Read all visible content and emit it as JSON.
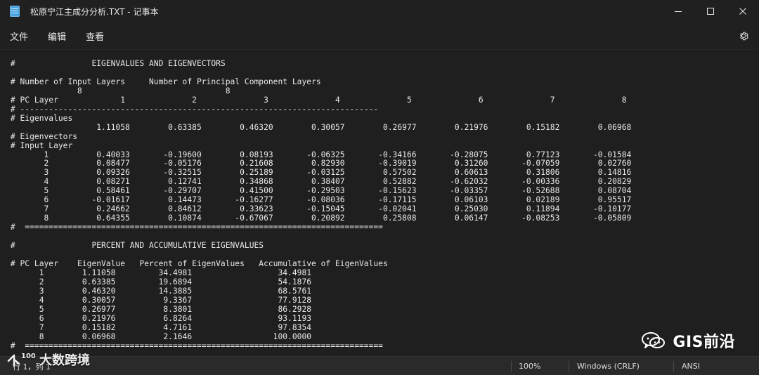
{
  "window": {
    "title": "松原宁江主成分分析.TXT - 记事本",
    "controls": [
      "minimize",
      "maximize",
      "close"
    ]
  },
  "menu": {
    "items": [
      "文件",
      "编辑",
      "查看"
    ],
    "settings_icon": "gear-icon"
  },
  "document": {
    "lines": [
      "#                EIGENVALUES AND EIGENVECTORS",
      "",
      "# Number of Input Layers     Number of Principal Component Layers",
      "              8                              8",
      "# PC Layer             1              2              3              4              5              6              7              8",
      "# ---------------------------------------------------------------------------",
      "# Eigenvalues",
      "                  1.11058        0.63385        0.46320        0.30057        0.26977        0.21976        0.15182        0.06968",
      "# Eigenvectors",
      "# Input Layer",
      "       1          0.40033       -0.19600        0.08193       -0.06325       -0.34166       -0.28075        0.77123       -0.01584",
      "       2          0.08477       -0.05176        0.21608        0.82930       -0.39019        0.31260       -0.07059        0.02760",
      "       3          0.09326       -0.32515        0.25189       -0.03125        0.57502        0.60613        0.31806        0.14816",
      "       4          0.08271        0.12741        0.34868        0.38407        0.52882       -0.62032       -0.00336        0.20829",
      "       5          0.58461       -0.29707        0.41500       -0.29503       -0.15623       -0.03357       -0.52688        0.08704",
      "       6         -0.01617        0.14473       -0.16277       -0.08036       -0.17115        0.06103        0.02189        0.95517",
      "       7          0.24662        0.84612        0.33623       -0.15045       -0.02041        0.25030        0.11894       -0.10177",
      "       8          0.64355        0.10874       -0.67067        0.20892        0.25808        0.06147       -0.08253       -0.05809",
      "#  ===========================================================================",
      "",
      "#                PERCENT AND ACCUMULATIVE EIGENVALUES",
      "",
      "# PC Layer    EigenValue   Percent of EigenValues   Accumulative of EigenValues",
      "      1        1.11058         34.4981                  34.4981",
      "      2        0.63385         19.6894                  54.1876",
      "      3        0.46320         14.3885                  68.5761",
      "      4        0.30057          9.3367                  77.9128",
      "      5        0.26977          8.3801                  86.2928",
      "      6        0.21976          6.8264                  93.1193",
      "      7        0.15182          4.7161                  97.8354",
      "      8        0.06968          2.1646                 100.0000",
      "#  ==========================================================================="
    ]
  },
  "status": {
    "cursor": "行 1，列 1",
    "zoom": "100%",
    "line_ending": "Windows (CRLF)",
    "encoding": "ANSI"
  },
  "watermarks": {
    "left_text": "大数跨境",
    "left_badge": "100",
    "right_text": "GIS前沿"
  }
}
